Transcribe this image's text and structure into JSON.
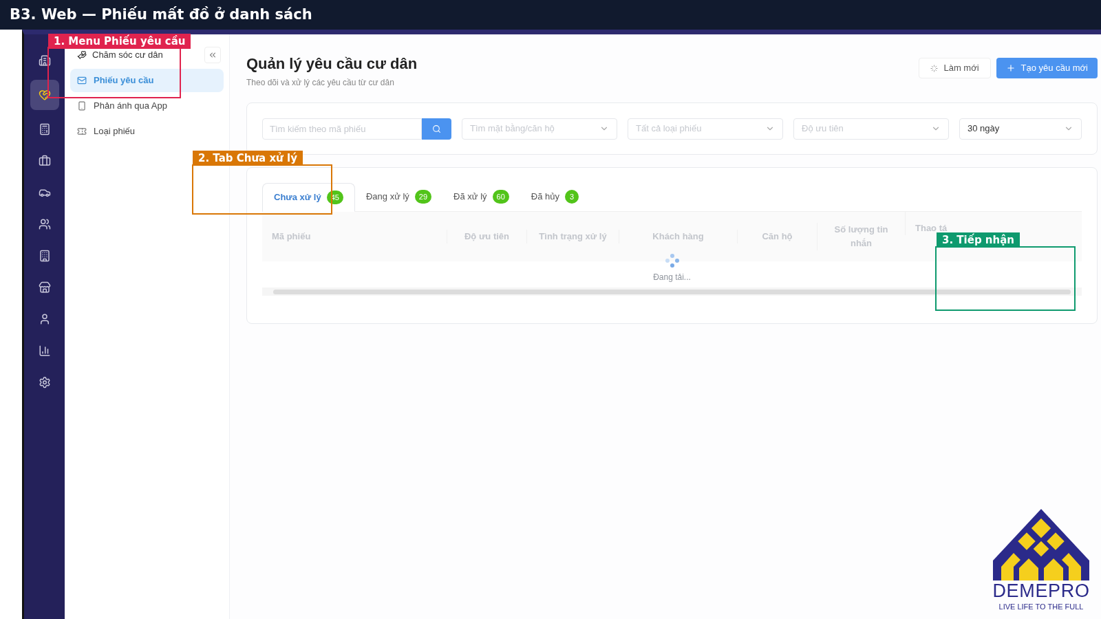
{
  "banner": {
    "title": "B3. Web — Phiếu mất đồ ở danh sách"
  },
  "annotations": [
    {
      "label": "1. Menu Phiếu yêu cầu",
      "color": "#e0234e"
    },
    {
      "label": "2. Tab Chưa xử lý",
      "color": "#d97706"
    },
    {
      "label": "3. Tiếp nhận",
      "color": "#0e9a6e"
    }
  ],
  "rail": [
    {
      "selected": false
    },
    {
      "selected": true
    },
    {
      "selected": false
    },
    {
      "selected": false
    },
    {
      "selected": false
    },
    {
      "selected": false
    },
    {
      "selected": false
    },
    {
      "selected": false
    },
    {
      "selected": false
    },
    {
      "selected": false
    },
    {
      "selected": false
    }
  ],
  "sidebar": {
    "section": "Chăm sóc cư dân",
    "items": [
      {
        "label": "Phiếu yêu cầu",
        "selected": true
      },
      {
        "label": "Phản ánh qua App",
        "selected": false
      },
      {
        "label": "Loại phiếu",
        "selected": false
      }
    ]
  },
  "page": {
    "title": "Quản lý yêu cầu cư dân",
    "subtitle": "Theo dõi và xử lý các yêu cầu từ cư dân"
  },
  "buttons": [
    {
      "label": "Làm mới",
      "kind": "refresh"
    },
    {
      "label": "Tạo yêu cầu mới",
      "kind": "primary"
    }
  ],
  "search": {
    "placeholder": "Tìm kiếm theo mã phiếu"
  },
  "filters": [
    {
      "placeholder": "Tìm mặt bằng/căn hộ"
    },
    {
      "placeholder": "Tất cả loại phiếu"
    },
    {
      "placeholder": "Độ ưu tiên"
    },
    {
      "value": "30 ngày"
    }
  ],
  "tabs": [
    {
      "label": "Chưa xử lý",
      "count": "45",
      "selected": true
    },
    {
      "label": "Đang xử lý",
      "count": "29",
      "selected": false
    },
    {
      "label": "Đã xử lý",
      "count": "60",
      "selected": false
    },
    {
      "label": "Đã hủy",
      "count": "3",
      "selected": false
    }
  ],
  "table": {
    "columns": [
      "Mã phiếu",
      "Độ ưu tiên",
      "Tình trạng xử lý",
      "Khách hàng",
      "Căn hộ",
      "Số lượng tin nhắn",
      "Thao tá"
    ],
    "loading": "Đang tải..."
  },
  "logo": {
    "name": "DEMEPRO",
    "slogan": "LIVE LIFE TO THE FULL"
  }
}
